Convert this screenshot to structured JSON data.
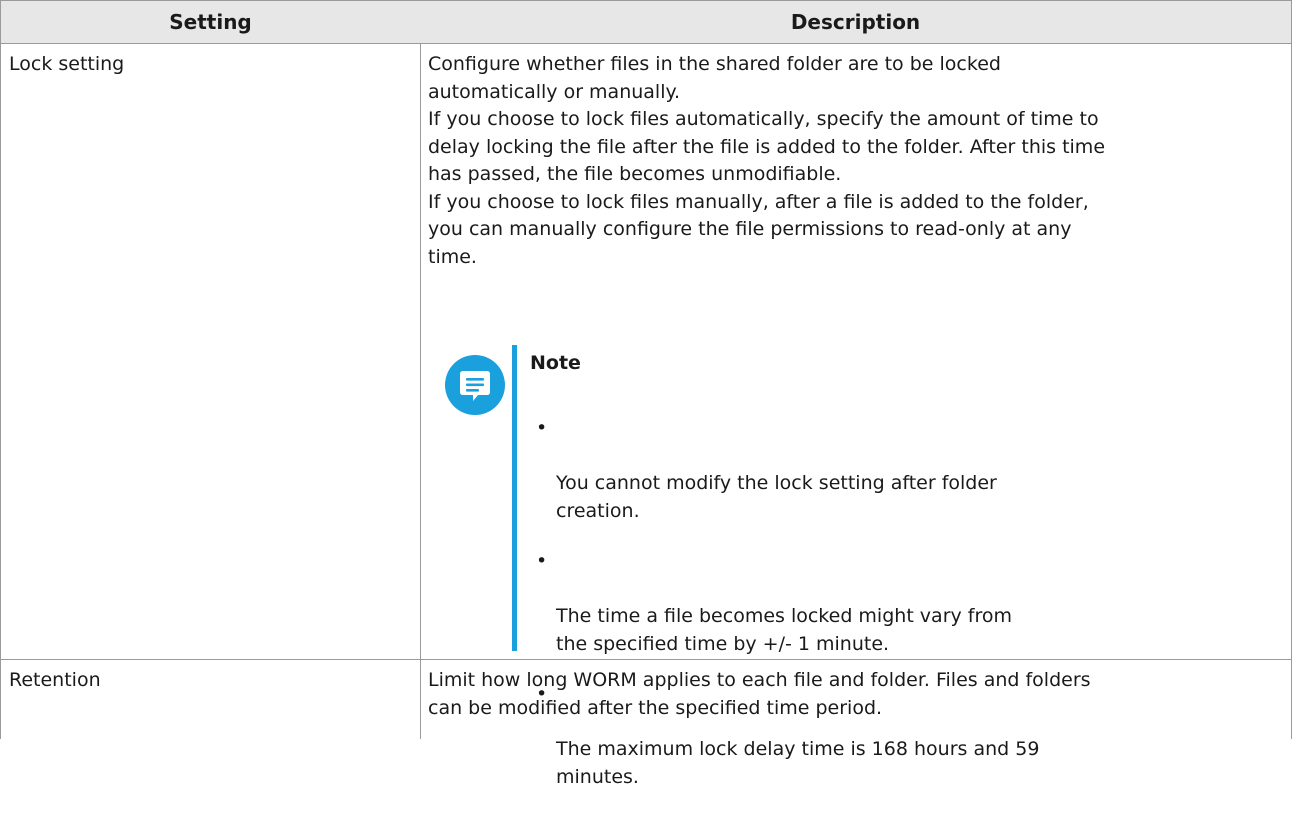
{
  "table": {
    "headers": [
      "Setting",
      "Description"
    ],
    "rows": [
      {
        "setting": "Lock setting",
        "description": [
          "Configure whether files in the shared folder are to be locked\nautomatically or manually.",
          "If you choose to lock files automatically, specify the amount of time to\ndelay locking the file after the file is added to the folder. After this time\nhas passed, the file becomes unmodifiable.",
          "If you choose to lock files manually, after a file is added to the folder,\nyou can manually configure the file permissions to read-only at any\ntime."
        ],
        "note": {
          "icon": "note-icon",
          "title": "Note",
          "items": [
            "You cannot modify the lock setting after folder\ncreation.",
            "The time a file becomes locked might vary from\nthe specified time by +/- 1 minute.",
            "The maximum lock delay time is 168 hours and 59\nminutes."
          ]
        }
      },
      {
        "setting": "Retention",
        "description": [
          "Limit how long WORM applies to each file and folder. Files and folders\ncan be modified after the specified time period."
        ]
      }
    ]
  },
  "colors": {
    "header_bg": "#e7e7e7",
    "border": "#9a9a9a",
    "note_accent": "#1aa0dc"
  }
}
